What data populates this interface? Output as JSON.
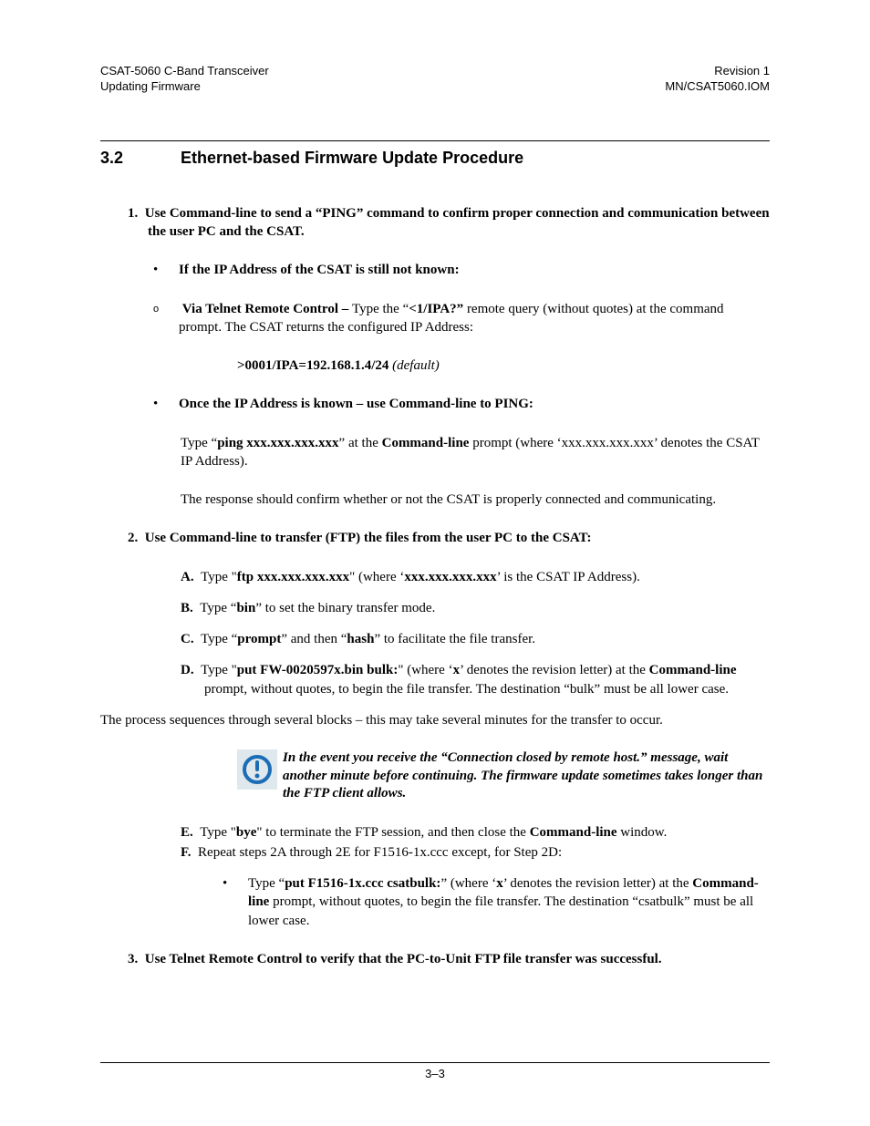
{
  "header": {
    "left1": "CSAT-5060 C-Band Transceiver",
    "left2": "Updating Firmware",
    "right1": "Revision 1",
    "right2": "MN/CSAT5060.IOM"
  },
  "section": {
    "number": "3.2",
    "title": "Ethernet-based Firmware Update Procedure"
  },
  "step1": {
    "marker": "1.",
    "text_a": "Use Command-line to send a “PING” command to confirm proper connection and communication between the user PC and the CSAT.",
    "bullet1": "If the IP Address of the CSAT is still not known:",
    "via_telnet_label": "Via Telnet Remote Control – ",
    "via_telnet_pre": "Type the “",
    "via_telnet_cmd": "<1/IPA?”",
    "via_telnet_post": " remote query (without quotes) at the command prompt. The CSAT returns the configured IP Address:",
    "ipa_response": ">0001/IPA=192.168.1.4/24",
    "ipa_default": "(default)",
    "bullet2": "Once the IP Address is known – use Command-line to PING:",
    "ping_pre": "Type “",
    "ping_cmd": "ping xxx.xxx.xxx.xxx",
    "ping_mid": "” at the ",
    "ping_cl": "Command-line",
    "ping_post": " prompt (where ‘xxx.xxx.xxx.xxx’ denotes the CSAT IP Address).",
    "ping_result": "The response should confirm whether or not the CSAT is properly connected and communicating."
  },
  "step2": {
    "marker": "2.",
    "text": "Use Command-line to transfer (FTP) the files from the user PC to the CSAT:",
    "A_marker": "A.",
    "A_pre": "Type \"",
    "A_cmd": "ftp xxx.xxx.xxx.xxx",
    "A_mid": "\" (where ‘",
    "A_where": "xxx.xxx.xxx.xxx",
    "A_post": "’ is the CSAT IP Address).",
    "B_marker": "B.",
    "B_pre": "Type “",
    "B_cmd": "bin",
    "B_post": "” to set the binary transfer mode.",
    "C_marker": "C.",
    "C_pre": "Type “",
    "C_cmd1": "prompt",
    "C_mid": "” and then “",
    "C_cmd2": "hash",
    "C_post": "” to facilitate the file transfer.",
    "D_marker": "D.",
    "D_pre": "Type \"",
    "D_cmd": "put FW-0020597x.bin bulk:",
    "D_mid": "\" (where ‘",
    "D_x": "x",
    "D_mid2": "’ denotes the revision letter) at the ",
    "D_cl": "Command-line",
    "D_post": " prompt, without quotes, to begin the file transfer. The destination “bulk” must be all lower case.",
    "process_note": "The process sequences through several blocks – this may take several minutes for the transfer to occur.",
    "warn": "In the event you receive the “Connection closed by remote host.” message, wait another minute before continuing. The firmware update sometimes takes longer than the FTP client allows.",
    "E_marker": "E.",
    "E_pre": "Type \"",
    "E_cmd": "bye",
    "E_mid": "\" to terminate the FTP session, and then close the ",
    "E_cl": "Command-line",
    "E_post": " window.",
    "F_marker": "F.",
    "F_text": "Repeat steps 2A through 2E for F1516-1x.ccc except, for Step 2D:",
    "F_sub_pre": "Type “",
    "F_sub_cmd": "put F1516-1x.ccc csatbulk:",
    "F_sub_mid": "” (where ‘",
    "F_sub_x": "x",
    "F_sub_mid2": "’ denotes the revision letter) at the ",
    "F_sub_cl": "Command-line",
    "F_sub_post": " prompt, without quotes, to begin the file transfer. The destination “csatbulk” must be all lower case."
  },
  "step3": {
    "marker": "3.",
    "text": "Use Telnet Remote Control to verify that the PC-to-Unit FTP file transfer was successful."
  },
  "footer": {
    "page": "3–3"
  }
}
